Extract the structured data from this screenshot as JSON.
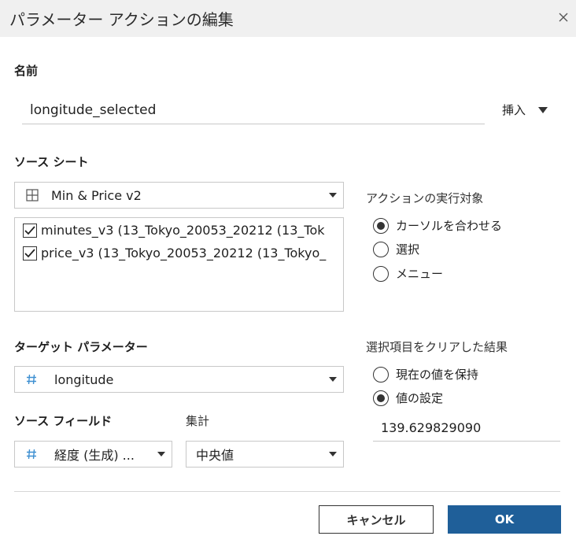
{
  "dialog": {
    "title": "パラメーター アクションの編集"
  },
  "name_section": {
    "label": "名前",
    "value": "longitude_selected",
    "insert_label": "挿入"
  },
  "source_sheet": {
    "label": "ソース シート",
    "selected": "Min & Price v2",
    "items": [
      {
        "label": "minutes_v3 (13_Tokyo_20053_20212 (13_Tok",
        "checked": true
      },
      {
        "label": "price_v3 (13_Tokyo_20053_20212 (13_Tokyo_",
        "checked": true
      }
    ]
  },
  "run_action_on": {
    "label": "アクションの実行対象",
    "options": [
      {
        "label": "カーソルを合わせる",
        "selected": true
      },
      {
        "label": "選択",
        "selected": false
      },
      {
        "label": "メニュー",
        "selected": false
      }
    ]
  },
  "target_parameter": {
    "label": "ターゲット パラメーター",
    "selected": "longitude"
  },
  "source_field": {
    "label": "ソース フィールド",
    "selected": "経度 (生成) ..."
  },
  "aggregation": {
    "label": "集計",
    "selected": "中央値"
  },
  "clear_result": {
    "label": "選択項目をクリアした結果",
    "options": [
      {
        "label": "現在の値を保持",
        "selected": false
      },
      {
        "label": "値の設定",
        "selected": true
      }
    ],
    "value": "139.629829090"
  },
  "footer": {
    "cancel_label": "キャンセル",
    "ok_label": "OK"
  },
  "colors": {
    "primary": "#1f5f99",
    "hash_icon": "#3d8fd1",
    "titlebar_bg": "#f0f0f0"
  },
  "icons": {
    "close": "close-icon",
    "sheet": "grid-icon",
    "field": "hash-icon"
  }
}
